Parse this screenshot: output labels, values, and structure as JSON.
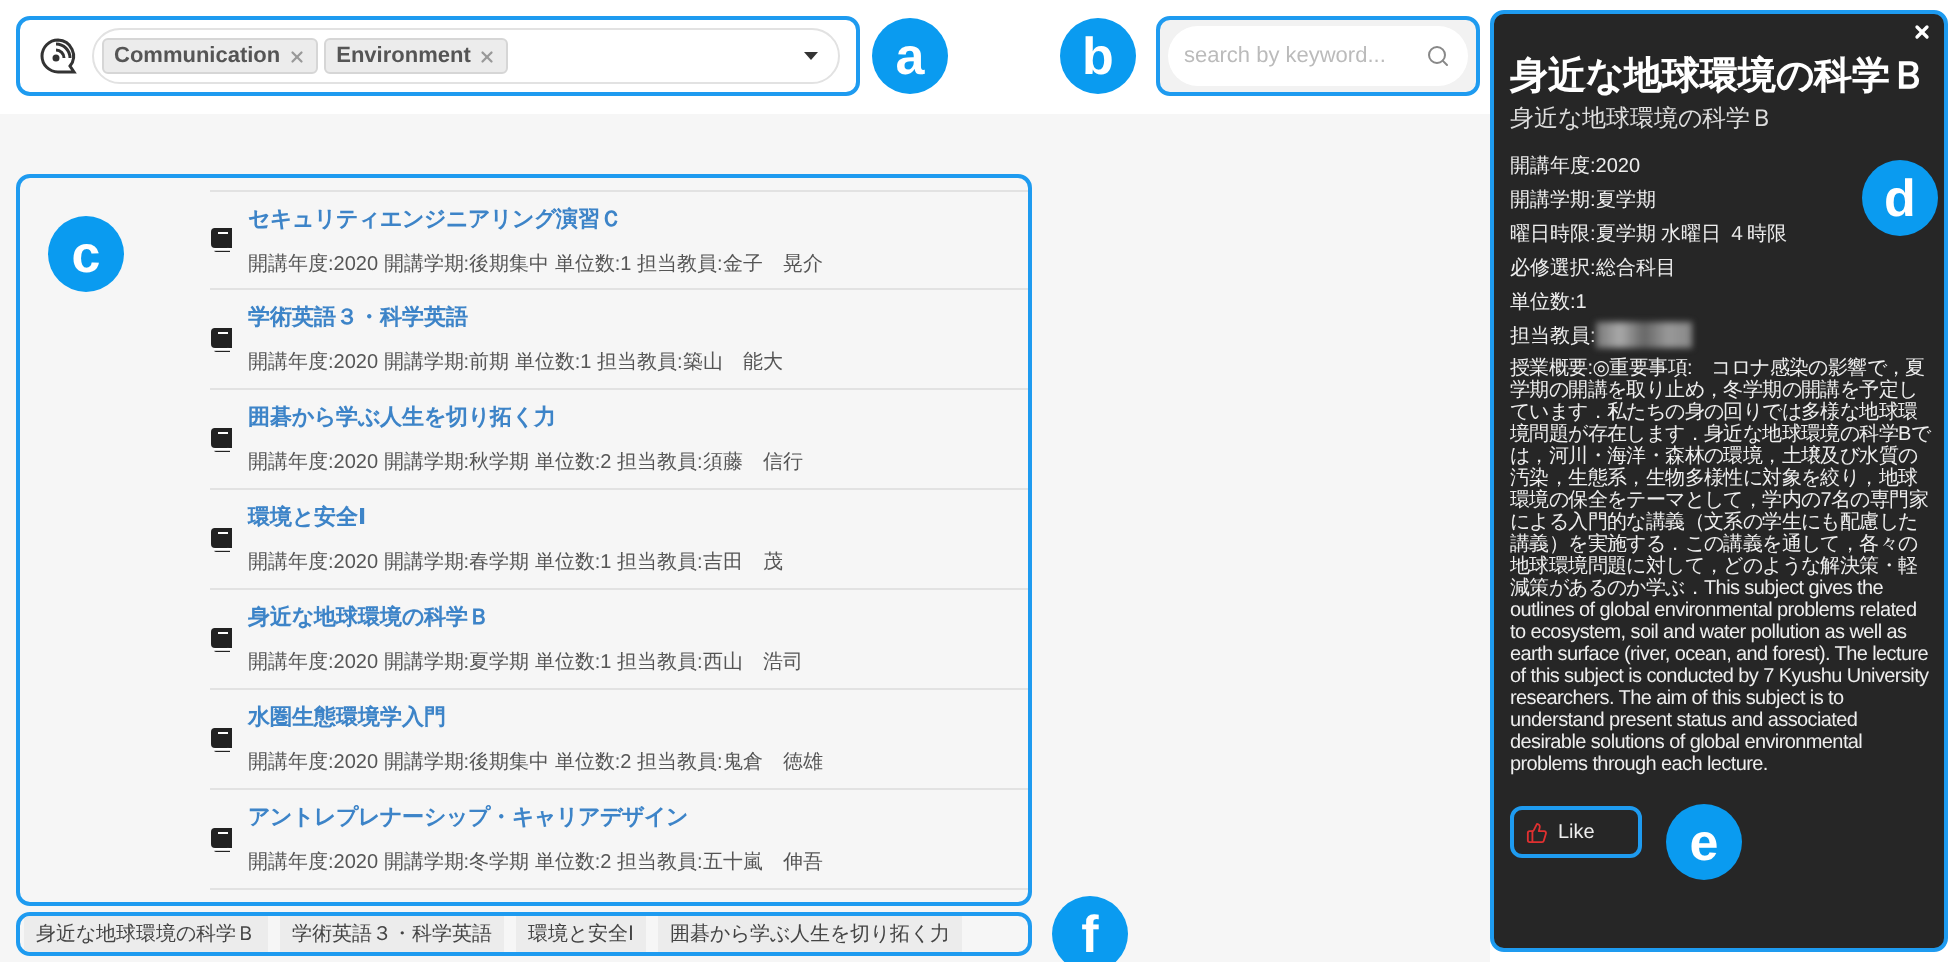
{
  "filter": {
    "tags": [
      {
        "label": "Communication"
      },
      {
        "label": "Environment"
      }
    ]
  },
  "search": {
    "placeholder": "search by keyword..."
  },
  "courses": [
    {
      "title": "セキュリティエンジニアリング演習Ｃ",
      "meta": "開講年度:2020 開講学期:後期集中 単位数:1 担当教員:金子　晃介"
    },
    {
      "title": "学術英語３・科学英語",
      "meta": "開講年度:2020 開講学期:前期 単位数:1 担当教員:築山　能大"
    },
    {
      "title": "囲碁から学ぶ人生を切り拓く力",
      "meta": "開講年度:2020 開講学期:秋学期 単位数:2 担当教員:須藤　信行"
    },
    {
      "title": "環境と安全Ⅰ",
      "meta": "開講年度:2020 開講学期:春学期 単位数:1 担当教員:吉田　茂"
    },
    {
      "title": "身近な地球環境の科学Ｂ",
      "meta": "開講年度:2020 開講学期:夏学期 単位数:1 担当教員:西山　浩司"
    },
    {
      "title": "水圏生態環境学入門",
      "meta": "開講年度:2020 開講学期:後期集中 単位数:2 担当教員:鬼倉　徳雄"
    },
    {
      "title": "アントレプレナーシップ・キャリアデザイン",
      "meta": "開講年度:2020 開講学期:冬学期 単位数:2 担当教員:五十嵐　伸吾"
    }
  ],
  "history": [
    "身近な地球環境の科学Ｂ",
    "学術英語３・科学英語",
    "環境と安全Ⅰ",
    "囲碁から学ぶ人生を切り拓く力"
  ],
  "detail": {
    "title": "身近な地球環境の科学Ｂ",
    "subtitle": "身近な地球環境の科学Ｂ",
    "fields": [
      "開講年度:2020",
      "開講学期:夏学期",
      "曜日時限:夏学期 水曜日 ４時限",
      "必修選択:総合科目",
      "単位数:1"
    ],
    "teacher_label": "担当教員:",
    "description": "授業概要:◎重要事項:　コロナ感染の影響で，夏学期の開講を取り止め，冬学期の開講を予定しています．私たちの身の回りでは多様な地球環境問題が存在します．身近な地球環境の科学Bでは，河川・海洋・森林の環境，土壌及び水質の汚染，生態系，生物多様性に対象を絞り，地球環境の保全をテーマとして，学内の7名の専門家による入門的な講義（文系の学生にも配慮した講義）を実施する．この講義を通して，各々の地球環境問題に対して，どのような解決策・軽減策があるのか学ぶ．This subject gives the outlines of global environmental problems related to ecosystem, soil and water pollution as well as earth surface (river, ocean, and forest). The lecture of this subject is conducted by 7 Kyushu University researchers. The aim of this subject is to understand present status and associated desirable solutions of global environmental problems through each lecture.",
    "like": "Like"
  },
  "callouts": [
    "a",
    "b",
    "c",
    "d",
    "e",
    "f"
  ]
}
